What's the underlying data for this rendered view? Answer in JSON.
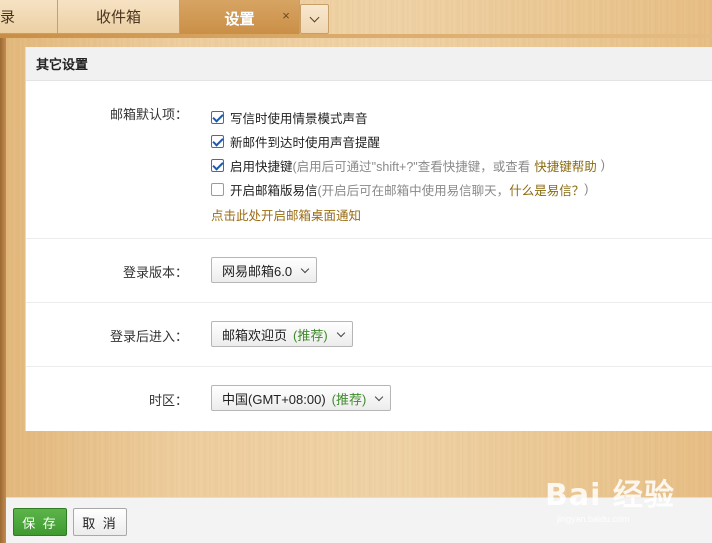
{
  "tabs": {
    "partial": "录",
    "inbox": "收件箱",
    "settings": "设置",
    "close_glyph": "×"
  },
  "panel": {
    "title": "其它设置"
  },
  "mailbox_defaults": {
    "label": "邮箱默认项：",
    "options": [
      {
        "checked": true,
        "text": "写信时使用情景模式声音"
      },
      {
        "checked": true,
        "text": "新邮件到达时使用声音提醒"
      },
      {
        "checked": true,
        "text": "启用快捷键",
        "hint": "(启用后可通过\"shift+?\"查看快捷键，或查看",
        "help": "快捷键帮助",
        "hint_end": ")"
      },
      {
        "checked": false,
        "text": "开启邮箱版易信",
        "hint": "(开启后可在邮箱中使用易信聊天，",
        "help": "什么是易信？",
        "hint_end": ")"
      }
    ],
    "desktop_notice_link": "点击此处开启邮箱桌面通知"
  },
  "login_version": {
    "label": "登录版本：",
    "value": "网易邮箱6.0"
  },
  "after_login": {
    "label": "登录后进入：",
    "value": "邮箱欢迎页",
    "recommend": "(推荐)"
  },
  "timezone": {
    "label": "时区：",
    "value": "中国(GMT+08:00)",
    "recommend": "(推荐)"
  },
  "buttons": {
    "save": "保 存",
    "cancel": "取 消"
  },
  "watermark": {
    "logo": "Bai 经验",
    "url": "jingyan.baidu.com"
  },
  "colors": {
    "active_tab": "#c98e45",
    "save_button": "#3e9a2f",
    "recommend": "#3f8a2c",
    "link": "#9a6b12",
    "checkbox": "#1f58b0"
  }
}
